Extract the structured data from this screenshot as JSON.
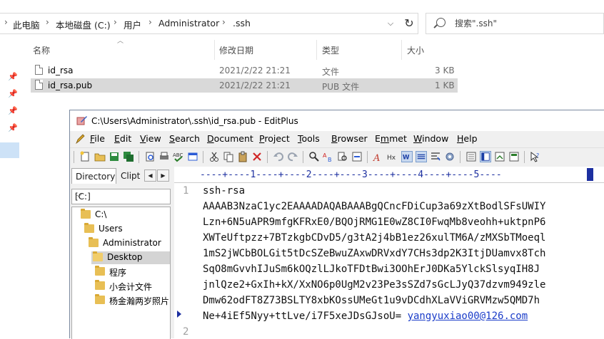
{
  "explorer": {
    "breadcrumbs": [
      "此电脑",
      "本地磁盘 (C:)",
      "用户",
      "Administrator",
      ".ssh"
    ],
    "search_placeholder": "搜索\".ssh\"",
    "columns": {
      "name": "名称",
      "date": "修改日期",
      "type": "类型",
      "size": "大小"
    },
    "files": [
      {
        "name": "id_rsa",
        "date": "2021/2/22 21:21",
        "type": "文件",
        "size": "3 KB"
      },
      {
        "name": "id_rsa.pub",
        "date": "2021/2/22 21:21",
        "type": "PUB 文件",
        "size": "1 KB"
      }
    ]
  },
  "editplus": {
    "title": "C:\\Users\\Administrator\\.ssh\\id_rsa.pub - EditPlus",
    "menu": [
      {
        "key": "F",
        "rest": "ile"
      },
      {
        "key": "E",
        "rest": "dit"
      },
      {
        "key": "V",
        "rest": "iew"
      },
      {
        "key": "S",
        "rest": "earch"
      },
      {
        "key": "D",
        "rest": "ocument"
      },
      {
        "key": "P",
        "rest": "roject"
      },
      {
        "key": "T",
        "rest": "ools"
      },
      {
        "key": "B",
        "rest": "rowser"
      },
      {
        "key": "m",
        "pre": "E",
        "rest": "met"
      },
      {
        "key": "W",
        "rest": "indow"
      },
      {
        "key": "H",
        "rest": "elp"
      }
    ],
    "side_tabs": {
      "directory": "Directory",
      "clip": "Clipt"
    },
    "drive": "[C:]",
    "tree": [
      "C:\\",
      "Users",
      "Administrator",
      "Desktop",
      "程序",
      "小会计文件",
      "杨金瀚两岁照片"
    ],
    "ruler": "----+----1----+----2----+----3----+----4----+----5----",
    "lines": [
      "ssh-rsa",
      "AAAAB3NzaC1yc2EAAAADAQABAAABgQCncFDiCup3a69zXtBodlSFsUWIY",
      "Lzn+6N5uAPR9mfgKFRxE0/BQOjRMG1E0wZ8CI0FwqMb8veohh+uktpnP6",
      "XWTeUftpzz+7BTzkgbCDvD5/g3tA2j4bB1ez26xulTM6A/zMXSbTMoeql",
      "1mS2jWCbBOLGit5tDcSZeBwuZAxwDRVxdY7CHs3dp2K3ItjDUamvx8Tch",
      "SqO8mGvvhIJuSm6kOQzlLJkoTFDtBwi3OOhErJ0DKa5YlckSlsyqIH8J",
      "jnlQze2+GxIh+kX/XxNO6p0UgM2v23Pe3sSZd7sGcLJyQ37dzvm949zle",
      "Dmw62odFT8Z73BSLTY8xbKOssUMeGt1u9vDCdhXLaVViGRVMzw5QMD7h",
      "Ne+4iEf5Nyy+ttLve/i7F5xeJDsGJsoU= "
    ],
    "email": "yangyuxiao00@126.com",
    "line_numbers": [
      "1",
      "2"
    ]
  }
}
